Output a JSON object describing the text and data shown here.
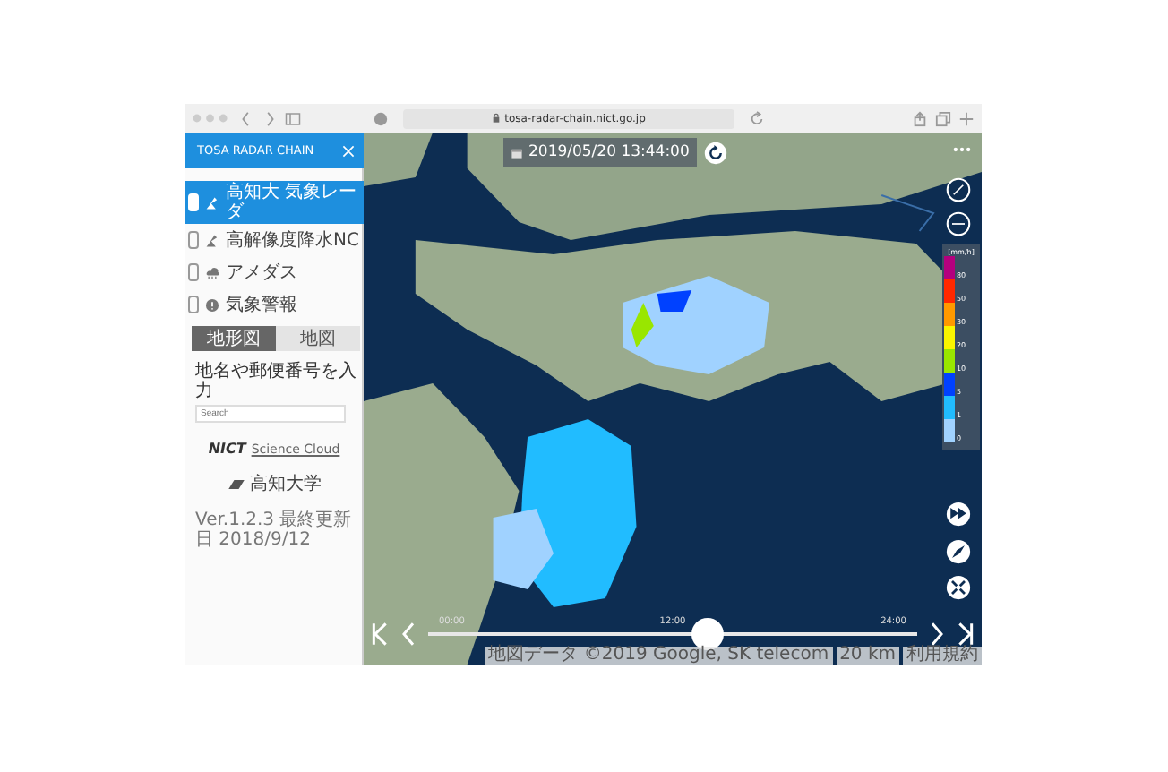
{
  "browser": {
    "url": "tosa-radar-chain.nict.go.jp"
  },
  "sidebar": {
    "title": "TOSA RADAR CHAIN",
    "layers": [
      {
        "label": "高知大 気象レーダ",
        "selected": true,
        "kind": "radar"
      },
      {
        "label": "高解像度降水NC",
        "selected": false,
        "kind": "nowcast"
      },
      {
        "label": "アメダス",
        "selected": false,
        "kind": "amedas"
      },
      {
        "label": "気象警報",
        "selected": false,
        "kind": "warning"
      }
    ],
    "tabs": [
      {
        "label": "地形図",
        "selected": true
      },
      {
        "label": "地図",
        "selected": false
      }
    ],
    "search": {
      "label": "地名や郵便番号を入力",
      "placeholder": "Search"
    },
    "logos": [
      {
        "kind": "nict",
        "mark": "NICT",
        "text": "Science Cloud"
      },
      {
        "kind": "univ",
        "text": "高知大学"
      }
    ],
    "version": "Ver.1.2.3 最終更新日 2018/9/12"
  },
  "map": {
    "datetime": "2019/05/20 13:44:00",
    "legend": {
      "unit": "[mm/h]",
      "levels": [
        {
          "label": "80",
          "color": "#b4007e"
        },
        {
          "label": "50",
          "color": "#ff2800"
        },
        {
          "label": "30",
          "color": "#ff9900"
        },
        {
          "label": "20",
          "color": "#faf500"
        },
        {
          "label": "10",
          "color": "#99e600"
        },
        {
          "label": "5",
          "color": "#0041ff"
        },
        {
          "label": "1",
          "color": "#21bcff"
        },
        {
          "label": "0",
          "color": "#a0d2ff"
        }
      ]
    },
    "timeline": {
      "ticks": [
        "00:00",
        "12:00",
        "24:00"
      ],
      "level": 0.57
    },
    "attribution": [
      "地図データ ©2019 Google, SK telecom",
      "20 km",
      "利用規約"
    ]
  }
}
